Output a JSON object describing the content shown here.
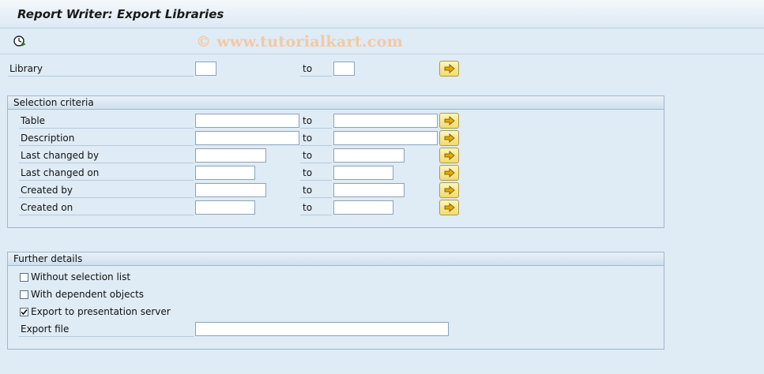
{
  "window": {
    "title": "Report Writer: Export Libraries"
  },
  "toolbar": {
    "execute_icon": "execute-clock-icon",
    "watermark": "© www.tutorialkart.com"
  },
  "library": {
    "label": "Library",
    "to": "to",
    "from_value": "",
    "to_value": ""
  },
  "selection_criteria": {
    "title": "Selection criteria",
    "rows": [
      {
        "label": "Table",
        "to": "to",
        "from_value": "",
        "to_value": ""
      },
      {
        "label": "Description",
        "to": "to",
        "from_value": "",
        "to_value": ""
      },
      {
        "label": "Last changed by",
        "to": "to",
        "from_value": "",
        "to_value": ""
      },
      {
        "label": "Last changed on",
        "to": "to",
        "from_value": "",
        "to_value": ""
      },
      {
        "label": "Created by",
        "to": "to",
        "from_value": "",
        "to_value": ""
      },
      {
        "label": "Created on",
        "to": "to",
        "from_value": "",
        "to_value": ""
      }
    ]
  },
  "further_details": {
    "title": "Further details",
    "options": [
      {
        "label": "Without selection list",
        "checked": false
      },
      {
        "label": "With dependent objects",
        "checked": false
      },
      {
        "label": "Export to presentation server",
        "checked": true
      }
    ],
    "export_file": {
      "label": "Export file",
      "value": ""
    }
  },
  "colors": {
    "background": "#dfebf5",
    "button_yellow": "#f1dc6e",
    "arrow_orange": "#e8a800"
  }
}
